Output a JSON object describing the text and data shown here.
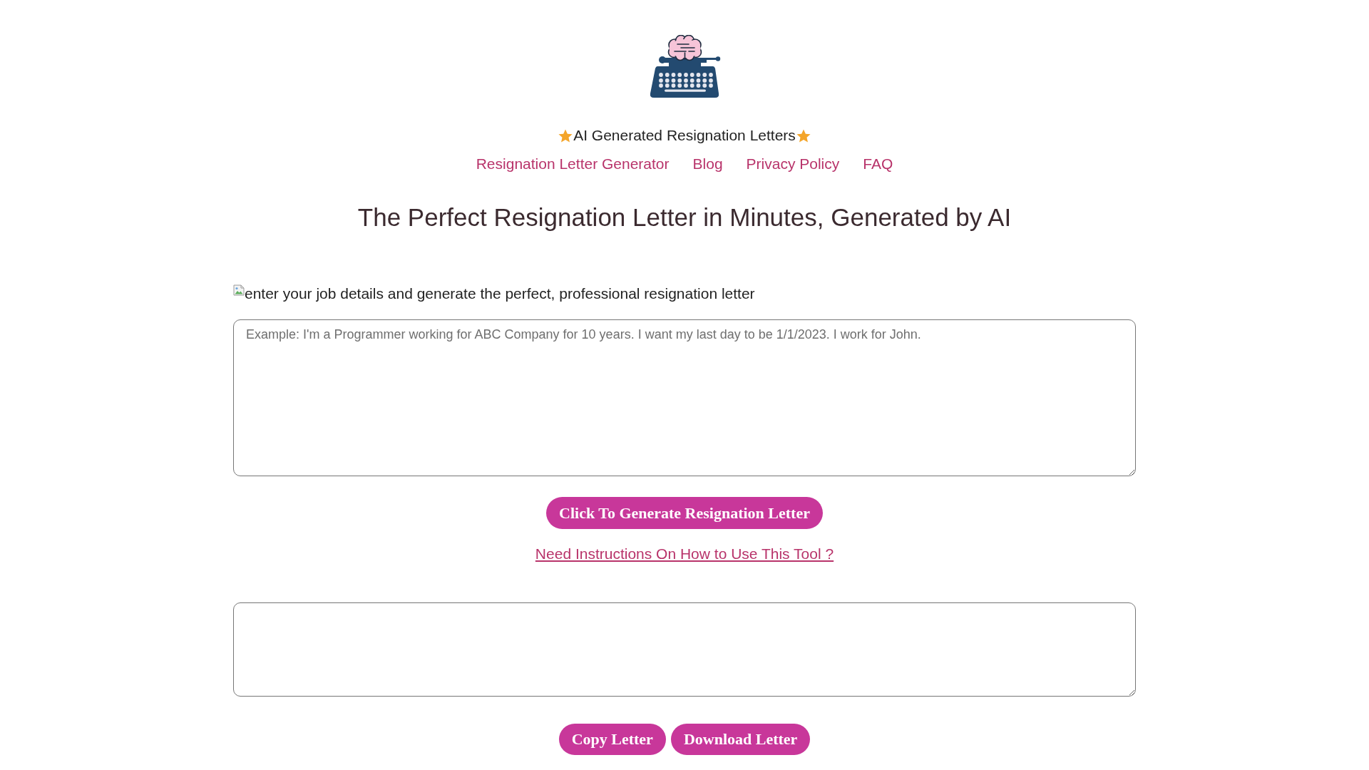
{
  "header": {
    "title": "AI Generated Resignation Letters"
  },
  "nav_links": [
    "Resignation Letter Generator",
    "Blog",
    "Privacy Policy",
    "FAQ"
  ],
  "heading": "The Perfect Resignation Letter in Minutes, Generated by AI",
  "form": {
    "image_alt": "enter your job details and generate the perfect, professional resignation letter",
    "input": {
      "placeholder": "Example: I'm a Programmer working for ABC Company for 10 years. I want my last day to be 1/1/2023. I work for John."
    },
    "generate_button": "Click To Generate Resignation Letter",
    "help_link": "Need Instructions On How to Use This Tool ?"
  },
  "actions": [
    "Copy Letter",
    "Download Letter"
  ]
}
